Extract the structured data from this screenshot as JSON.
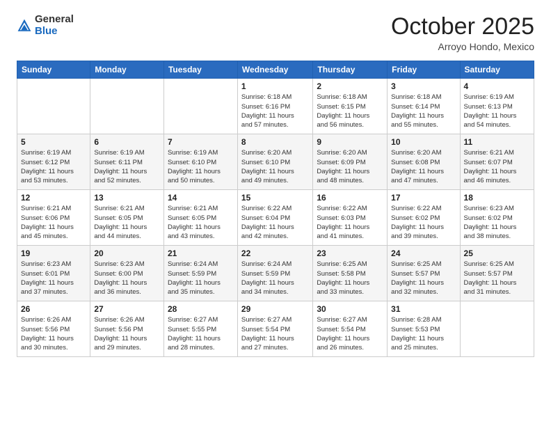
{
  "logo": {
    "general": "General",
    "blue": "Blue"
  },
  "header": {
    "month": "October 2025",
    "location": "Arroyo Hondo, Mexico"
  },
  "days_of_week": [
    "Sunday",
    "Monday",
    "Tuesday",
    "Wednesday",
    "Thursday",
    "Friday",
    "Saturday"
  ],
  "weeks": [
    [
      {
        "num": "",
        "info": ""
      },
      {
        "num": "",
        "info": ""
      },
      {
        "num": "",
        "info": ""
      },
      {
        "num": "1",
        "info": "Sunrise: 6:18 AM\nSunset: 6:16 PM\nDaylight: 11 hours\nand 57 minutes."
      },
      {
        "num": "2",
        "info": "Sunrise: 6:18 AM\nSunset: 6:15 PM\nDaylight: 11 hours\nand 56 minutes."
      },
      {
        "num": "3",
        "info": "Sunrise: 6:18 AM\nSunset: 6:14 PM\nDaylight: 11 hours\nand 55 minutes."
      },
      {
        "num": "4",
        "info": "Sunrise: 6:19 AM\nSunset: 6:13 PM\nDaylight: 11 hours\nand 54 minutes."
      }
    ],
    [
      {
        "num": "5",
        "info": "Sunrise: 6:19 AM\nSunset: 6:12 PM\nDaylight: 11 hours\nand 53 minutes."
      },
      {
        "num": "6",
        "info": "Sunrise: 6:19 AM\nSunset: 6:11 PM\nDaylight: 11 hours\nand 52 minutes."
      },
      {
        "num": "7",
        "info": "Sunrise: 6:19 AM\nSunset: 6:10 PM\nDaylight: 11 hours\nand 50 minutes."
      },
      {
        "num": "8",
        "info": "Sunrise: 6:20 AM\nSunset: 6:10 PM\nDaylight: 11 hours\nand 49 minutes."
      },
      {
        "num": "9",
        "info": "Sunrise: 6:20 AM\nSunset: 6:09 PM\nDaylight: 11 hours\nand 48 minutes."
      },
      {
        "num": "10",
        "info": "Sunrise: 6:20 AM\nSunset: 6:08 PM\nDaylight: 11 hours\nand 47 minutes."
      },
      {
        "num": "11",
        "info": "Sunrise: 6:21 AM\nSunset: 6:07 PM\nDaylight: 11 hours\nand 46 minutes."
      }
    ],
    [
      {
        "num": "12",
        "info": "Sunrise: 6:21 AM\nSunset: 6:06 PM\nDaylight: 11 hours\nand 45 minutes."
      },
      {
        "num": "13",
        "info": "Sunrise: 6:21 AM\nSunset: 6:05 PM\nDaylight: 11 hours\nand 44 minutes."
      },
      {
        "num": "14",
        "info": "Sunrise: 6:21 AM\nSunset: 6:05 PM\nDaylight: 11 hours\nand 43 minutes."
      },
      {
        "num": "15",
        "info": "Sunrise: 6:22 AM\nSunset: 6:04 PM\nDaylight: 11 hours\nand 42 minutes."
      },
      {
        "num": "16",
        "info": "Sunrise: 6:22 AM\nSunset: 6:03 PM\nDaylight: 11 hours\nand 41 minutes."
      },
      {
        "num": "17",
        "info": "Sunrise: 6:22 AM\nSunset: 6:02 PM\nDaylight: 11 hours\nand 39 minutes."
      },
      {
        "num": "18",
        "info": "Sunrise: 6:23 AM\nSunset: 6:02 PM\nDaylight: 11 hours\nand 38 minutes."
      }
    ],
    [
      {
        "num": "19",
        "info": "Sunrise: 6:23 AM\nSunset: 6:01 PM\nDaylight: 11 hours\nand 37 minutes."
      },
      {
        "num": "20",
        "info": "Sunrise: 6:23 AM\nSunset: 6:00 PM\nDaylight: 11 hours\nand 36 minutes."
      },
      {
        "num": "21",
        "info": "Sunrise: 6:24 AM\nSunset: 5:59 PM\nDaylight: 11 hours\nand 35 minutes."
      },
      {
        "num": "22",
        "info": "Sunrise: 6:24 AM\nSunset: 5:59 PM\nDaylight: 11 hours\nand 34 minutes."
      },
      {
        "num": "23",
        "info": "Sunrise: 6:25 AM\nSunset: 5:58 PM\nDaylight: 11 hours\nand 33 minutes."
      },
      {
        "num": "24",
        "info": "Sunrise: 6:25 AM\nSunset: 5:57 PM\nDaylight: 11 hours\nand 32 minutes."
      },
      {
        "num": "25",
        "info": "Sunrise: 6:25 AM\nSunset: 5:57 PM\nDaylight: 11 hours\nand 31 minutes."
      }
    ],
    [
      {
        "num": "26",
        "info": "Sunrise: 6:26 AM\nSunset: 5:56 PM\nDaylight: 11 hours\nand 30 minutes."
      },
      {
        "num": "27",
        "info": "Sunrise: 6:26 AM\nSunset: 5:56 PM\nDaylight: 11 hours\nand 29 minutes."
      },
      {
        "num": "28",
        "info": "Sunrise: 6:27 AM\nSunset: 5:55 PM\nDaylight: 11 hours\nand 28 minutes."
      },
      {
        "num": "29",
        "info": "Sunrise: 6:27 AM\nSunset: 5:54 PM\nDaylight: 11 hours\nand 27 minutes."
      },
      {
        "num": "30",
        "info": "Sunrise: 6:27 AM\nSunset: 5:54 PM\nDaylight: 11 hours\nand 26 minutes."
      },
      {
        "num": "31",
        "info": "Sunrise: 6:28 AM\nSunset: 5:53 PM\nDaylight: 11 hours\nand 25 minutes."
      },
      {
        "num": "",
        "info": ""
      }
    ]
  ]
}
